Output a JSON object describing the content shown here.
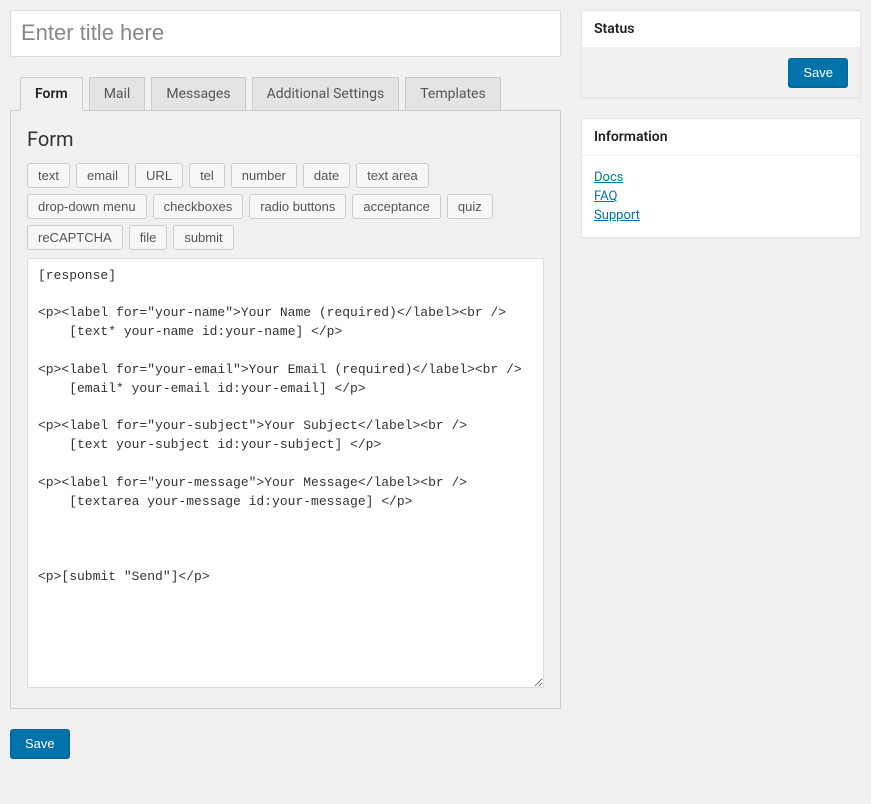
{
  "title_placeholder": "Enter title here",
  "title_value": "",
  "tabs": [
    {
      "label": "Form",
      "active": true
    },
    {
      "label": "Mail",
      "active": false
    },
    {
      "label": "Messages",
      "active": false
    },
    {
      "label": "Additional Settings",
      "active": false
    },
    {
      "label": "Templates",
      "active": false
    }
  ],
  "panel": {
    "heading": "Form",
    "tag_buttons": [
      "text",
      "email",
      "URL",
      "tel",
      "number",
      "date",
      "text area",
      "drop-down menu",
      "checkboxes",
      "radio buttons",
      "acceptance",
      "quiz",
      "reCAPTCHA",
      "file",
      "submit"
    ],
    "form_code": "[response]\n\n<p><label for=\"your-name\">Your Name (required)</label><br />\n    [text* your-name id:your-name] </p>\n\n<p><label for=\"your-email\">Your Email (required)</label><br />\n    [email* your-email id:your-email] </p>\n\n<p><label for=\"your-subject\">Your Subject</label><br />\n    [text your-subject id:your-subject] </p>\n\n<p><label for=\"your-message\">Your Message</label><br />\n    [textarea your-message id:your-message] </p>\n\n\n\n<p>[submit \"Send\"]</p>"
  },
  "buttons": {
    "save": "Save"
  },
  "status_box": {
    "title": "Status"
  },
  "info_box": {
    "title": "Information",
    "links": [
      "Docs",
      "FAQ",
      "Support"
    ]
  }
}
